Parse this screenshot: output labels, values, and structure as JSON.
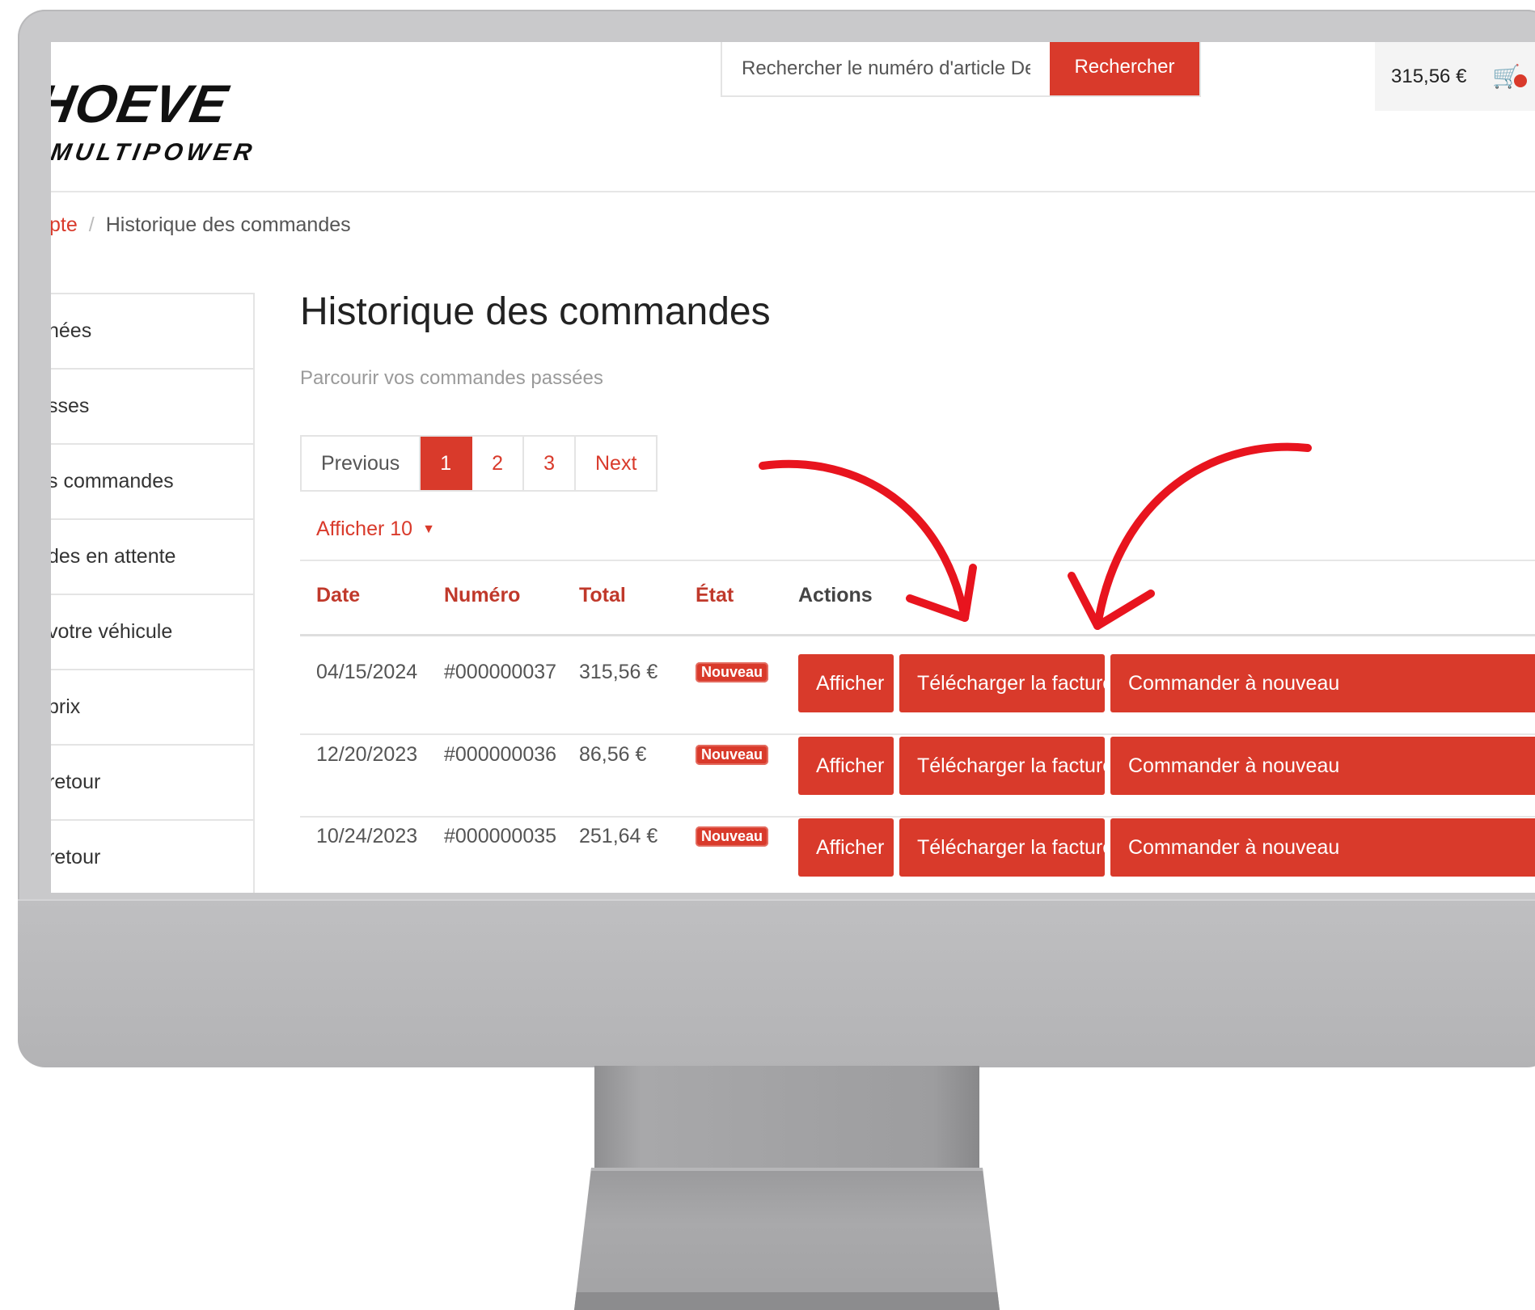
{
  "header": {
    "logo_main": "HOEVE",
    "logo_sub": "MULTIPOWER",
    "search_placeholder": "Rechercher le numéro d'article De Hoeve",
    "search_button": "Rechercher",
    "cart_total": "315,56 €",
    "cart_icon": "shopping-cart-icon"
  },
  "breadcrumb": {
    "parent": "pte",
    "separator": "/",
    "current": "Historique des commandes"
  },
  "sidebar": {
    "items": [
      {
        "label": "nées"
      },
      {
        "label": "sses"
      },
      {
        "label": "s commandes"
      },
      {
        "label": "des en attente"
      },
      {
        "label": "votre véhicule"
      },
      {
        "label": "prix"
      },
      {
        "label": "retour"
      },
      {
        "label": "retour"
      }
    ]
  },
  "main": {
    "title": "Historique des commandes",
    "subtitle": "Parcourir vos commandes passées",
    "pagination": {
      "previous": "Previous",
      "pages": [
        "1",
        "2",
        "3"
      ],
      "active_page": "1",
      "next": "Next"
    },
    "per_page": "Afficher 10",
    "table": {
      "headers": [
        "Date",
        "Numéro",
        "Total",
        "État",
        "Actions"
      ],
      "rows": [
        {
          "date": "04/15/2024",
          "number": "#000000037",
          "total": "315,56 €",
          "status": "Nouveau"
        },
        {
          "date": "12/20/2023",
          "number": "#000000036",
          "total": "86,56 €",
          "status": "Nouveau"
        },
        {
          "date": "10/24/2023",
          "number": "#000000035",
          "total": "251,64 €",
          "status": "Nouveau"
        }
      ],
      "actions": {
        "view": "Afficher",
        "invoice": "Télécharger la facture",
        "reorder": "Commander à nouveau"
      }
    }
  },
  "colors": {
    "accent": "#d93a2b",
    "bezel": "#c9c9cb",
    "stand": "#a2a2a4",
    "annotation_arrow": "#e8141e"
  }
}
